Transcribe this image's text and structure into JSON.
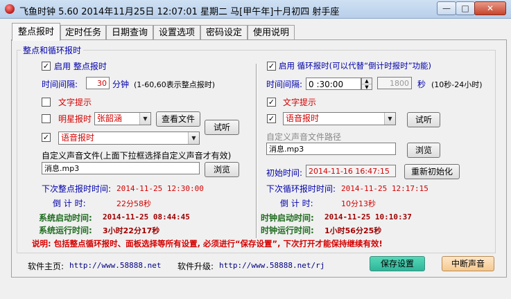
{
  "window": {
    "title": "飞鱼时钟 5.60 2014年11月25日 12:07:01 星期二 马[甲午年]十月初四 射手座",
    "minimize_label": "—",
    "maximize_label": "□",
    "close_label": "✕"
  },
  "tabs": [
    {
      "label": "整点报时",
      "active": true
    },
    {
      "label": "定时任务"
    },
    {
      "label": "日期查询"
    },
    {
      "label": "设置选项"
    },
    {
      "label": "密码设定"
    },
    {
      "label": "使用说明"
    }
  ],
  "group_title": "整点和循环报时",
  "left": {
    "enable_label": "启用 整点报时",
    "interval_label": "时间间隔:",
    "interval_value": "30",
    "interval_unit": "分钟",
    "interval_hint": "(1-60,60表示整点报时)",
    "text_prompt_label": "文字提示",
    "star_label": "明星报时",
    "star_select": "张韶涵",
    "view_file_button": "查看文件",
    "test_button": "试听",
    "voice_select": "语音报时",
    "custom_sound_label": "自定义声音文件(上面下拉框选择自定义声音才有效)",
    "custom_sound_value": "消息.mp3",
    "browse_button": "浏览",
    "next_label": "下次整点报时时间:",
    "next_value": "2014-11-25 12:30:00",
    "countdown_label": "倒 计 时:",
    "countdown_value": "22分58秒",
    "sys_start_label": "系统启动时间:",
    "sys_start_value": "2014-11-25 08:44:45",
    "sys_run_label": "系统运行时间:",
    "sys_run_value": "3小时22分17秒"
  },
  "right": {
    "enable_label": "启用 循环报时(可以代替“倒计时报时”功能)",
    "interval_label": "时间间隔:",
    "interval_value": "0 :30:00",
    "seconds_value": "1800",
    "seconds_unit": "秒",
    "seconds_hint": "(10秒-24小时)",
    "text_prompt_label": "文字提示",
    "voice_select": "语音报时",
    "test_button": "试听",
    "custom_path_label": "自定义声音文件路径",
    "custom_path_value": "消息.mp3",
    "browse_button": "浏览",
    "init_label": "初始时间:",
    "init_value": "2014-11-16 16:47:15",
    "reinit_button": "重新初始化",
    "next_label": "下次循环报时时间:",
    "next_value": "2014-11-25 12:17:15",
    "countdown_label": "倒 计 时:",
    "countdown_value": "10分13秒",
    "clock_start_label": "时钟启动时间:",
    "clock_start_value": "2014-11-25 10:10:37",
    "clock_run_label": "时钟运行时间:",
    "clock_run_value": "1小时56分25秒"
  },
  "notice": "说明: 包括整点循环报时、面板选择等所有设置, 必须进行“保存设置”, 下次打开才能保持继续有效!",
  "footer": {
    "home_label": "软件主页:",
    "home_url": "http://www.58888.net",
    "upgrade_label": "软件升级:",
    "upgrade_url": "http://www.58888.net/rj",
    "save_button": "保存设置",
    "stop_button": "中断声音"
  },
  "check_mark": "✓"
}
